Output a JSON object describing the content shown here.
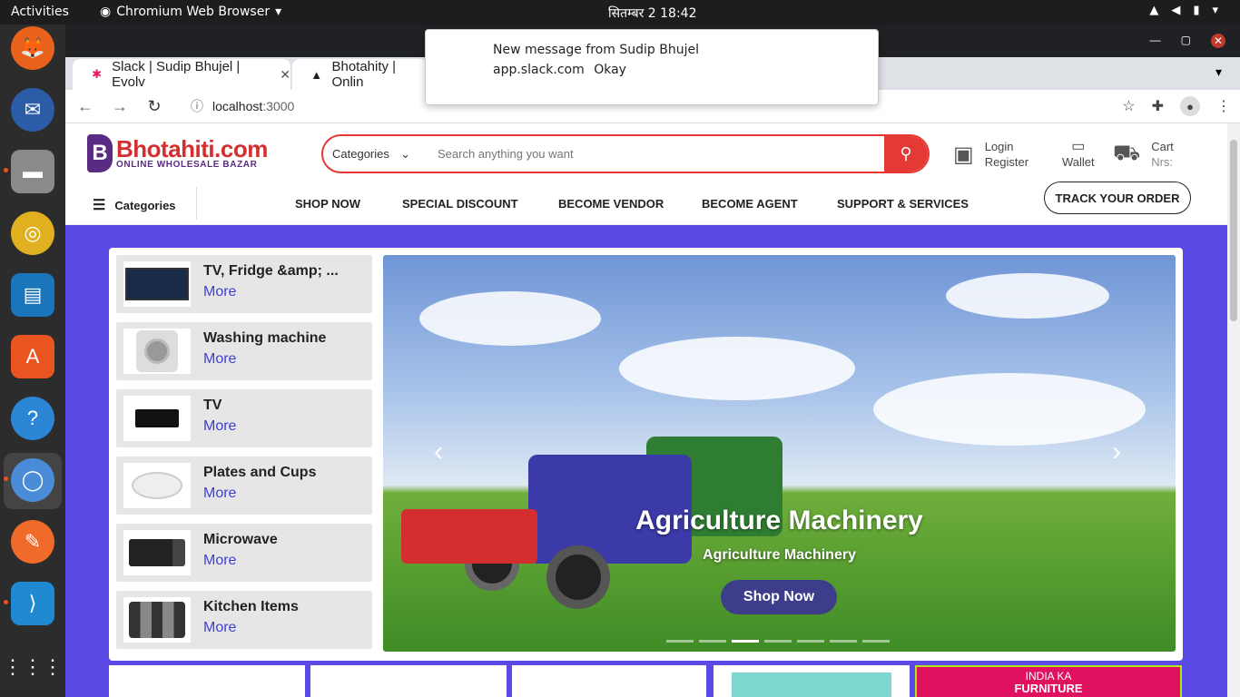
{
  "topbar": {
    "activities": "Activities",
    "app_name": "Chromium Web Browser",
    "clock": "सितम्बर 2  18:42"
  },
  "notification": {
    "title": "New message from Sudip Bhujel",
    "source": "app.slack.com",
    "action": "Okay"
  },
  "tabs": [
    {
      "label": "Slack | Sudip Bhujel | Evolv",
      "icon": "slack-icon"
    },
    {
      "label": "Bhotahity | Onlin",
      "icon": "site-icon"
    }
  ],
  "toolbar": {
    "url_host": "localhost",
    "url_port": ":3000"
  },
  "site": {
    "logo_name": "Bhotahiti.com",
    "logo_tagline": "ONLINE WHOLESALE BAZAR",
    "search_category": "Categories",
    "search_placeholder": "Search anything you want",
    "login": "Login",
    "register": "Register",
    "wallet": "Wallet",
    "cart": "Cart",
    "cart_amount": "Nrs:"
  },
  "nav": {
    "categories": "Categories",
    "links": [
      "SHOP NOW",
      "SPECIAL DISCOUNT",
      "BECOME VENDOR",
      "BECOME AGENT",
      "SUPPORT & SERVICES"
    ],
    "track": "TRACK YOUR ORDER"
  },
  "categories": [
    {
      "title": "TV, Fridge &amp; ...",
      "more": "More",
      "icon": "tv-icon"
    },
    {
      "title": "Washing machine",
      "more": "More",
      "icon": "washing-machine-icon"
    },
    {
      "title": "TV",
      "more": "More",
      "icon": "tv-icon"
    },
    {
      "title": "Plates and Cups",
      "more": "More",
      "icon": "plates-icon"
    },
    {
      "title": "Microwave",
      "more": "More",
      "icon": "microwave-icon"
    },
    {
      "title": "Kitchen Items",
      "more": "More",
      "icon": "kitchen-icon"
    }
  ],
  "slider": {
    "title": "Agriculture Machinery",
    "subtitle": "Agriculture Machinery",
    "button": "Shop Now",
    "active_slide": 3,
    "slide_count": 7
  },
  "promo": {
    "line1": "INDIA KA",
    "line2": "FURNITURE"
  },
  "colors": {
    "accent": "#e53935",
    "brand_purple": "#5a2b82",
    "hero_bg": "#5c4ae6"
  }
}
